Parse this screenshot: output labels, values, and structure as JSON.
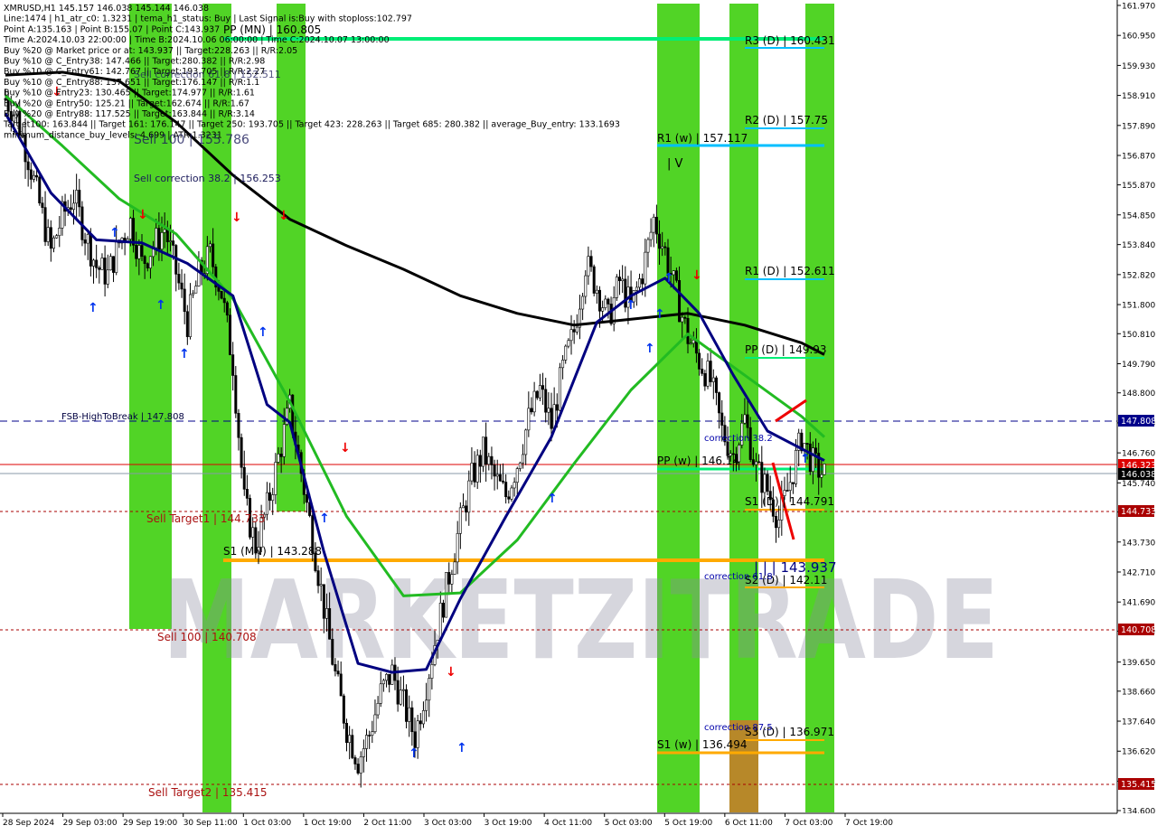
{
  "header_lines": [
    "XMRUSD,H1  145.157 146.038 145.144 146.038",
    "Line:1474 | h1_atr_c0: 1.3231 | tema_h1_status: Buy | Last Signal is:Buy with stoploss:102.797",
    "Point A:135.163 | Point B:155.07 | Point C:143.937",
    "Time A:2024.10.03 22:00:00 | Time B:2024.10.06 06:00:00 | Time C:2024.10.07 13:00:00",
    "Buy %20 @ Market price or at: 143.937 || Target:228.263 || R/R:2.05",
    "Buy %10 @ C_Entry38: 147.466 || Target:280.382 || R/R:2.98",
    "Buy %10 @ C_Entry61: 142.767 || Target:193.705 || R/R:2.27",
    "Buy %10 @ C_Entry88: 137.651 || Target:176.147 || R/R:1.1",
    "Buy %10 @ Entry23: 130.465 || Target:174.977 || R/R:1.61",
    "Buy %20 @ Entry50: 125.21 || Target:162.674 || R/R:1.67",
    "Buy %20 @ Entry88: 117.525 || Target:163.844 || R/R:3.14",
    "Target100: 163.844 || Target 161: 176.147 || Target 250: 193.705 || Target 423: 228.263 || Target 685: 280.382 || average_Buy_entry: 133.1693",
    "minimum_distance_buy_levels: 4.699 | ATR:1.3231"
  ],
  "overlay_labels": {
    "sell_correction_text": "Sell correction 38.2 | 156.253",
    "overlap_text_1": "Sell correction 61.8 | 152.511",
    "overlap_text_2": "Sell 100 | 155.786",
    "fsb_label": "FSB-HighToBreak | 147.808",
    "sell_target1": "Sell Target1 | 144.733",
    "sell_100": "Sell 100 | 140.708",
    "sell_target2": "Sell Target2 | 135.415",
    "pp_mn": "PP (MN) | 160.805",
    "s1_mn": "S1 (MN) | 143.288",
    "r3_d": "R3 (D) | 160.431",
    "r2_d": "R2 (D) | 157.75",
    "r1_w": "R1 (w) | 157.117",
    "r1_d": "R1 (D) | 152.611",
    "pp_d": "PP (D) | 149.93",
    "pp_w": "PP (w) | 146.14",
    "s1_d": "S1 (D) | 144.791",
    "s2_d": "S2 (D) | 142.11",
    "s3_d": "S3 (D) | 136.971",
    "s1_w": "S1 (w) | 136.494",
    "point_c_label": "| | | 143.937",
    "corr_382": "correction 38.2",
    "corr_618": "correction 61.8",
    "corr_875": "correction 87.5",
    "wave_mark": "| V",
    "watermark": "MARKETZITRADE"
  },
  "chart_data": {
    "type": "candlestick",
    "symbol": "XMRUSD",
    "timeframe": "H1",
    "ylim": [
      134.6,
      162.0
    ],
    "y_ticks": [
      161.97,
      160.95,
      159.93,
      158.91,
      157.89,
      156.87,
      155.87,
      154.85,
      153.84,
      152.82,
      151.8,
      150.81,
      149.79,
      148.8,
      147.78,
      146.76,
      145.74,
      144.75,
      143.73,
      142.71,
      141.69,
      140.7,
      139.65,
      138.66,
      137.64,
      136.62,
      135.6,
      134.6
    ],
    "x_ticks": [
      "28 Sep 2024",
      "29 Sep 03:00",
      "29 Sep 19:00",
      "30 Sep 11:00",
      "1 Oct 03:00",
      "1 Oct 19:00",
      "2 Oct 11:00",
      "3 Oct 03:00",
      "3 Oct 19:00",
      "4 Oct 11:00",
      "5 Oct 03:00",
      "5 Oct 19:00",
      "6 Oct 11:00",
      "7 Oct 03:00",
      "7 Oct 19:00"
    ],
    "close_path": [
      [
        0,
        158.8
      ],
      [
        4,
        158.2
      ],
      [
        8,
        156.8
      ],
      [
        12,
        155.2
      ],
      [
        16,
        153.6
      ],
      [
        20,
        154.8
      ],
      [
        24,
        155.5
      ],
      [
        28,
        154.2
      ],
      [
        32,
        153.1
      ],
      [
        36,
        152.8
      ],
      [
        40,
        153.9
      ],
      [
        44,
        154.6
      ],
      [
        48,
        153.2
      ],
      [
        52,
        153.8
      ],
      [
        56,
        154.4
      ],
      [
        60,
        152.9
      ],
      [
        64,
        151.2
      ],
      [
        68,
        152.8
      ],
      [
        72,
        153.5
      ],
      [
        76,
        152.2
      ],
      [
        80,
        149.8
      ],
      [
        84,
        145.1
      ],
      [
        88,
        143.6
      ],
      [
        92,
        144.9
      ],
      [
        96,
        146.6
      ],
      [
        100,
        148.3
      ],
      [
        104,
        146.1
      ],
      [
        108,
        143.9
      ],
      [
        112,
        141.5
      ],
      [
        116,
        139.2
      ],
      [
        120,
        137.4
      ],
      [
        124,
        136.3
      ],
      [
        128,
        137.2
      ],
      [
        132,
        138.6
      ],
      [
        136,
        139.3
      ],
      [
        140,
        138.2
      ],
      [
        144,
        137.1
      ],
      [
        148,
        138.9
      ],
      [
        152,
        140.8
      ],
      [
        156,
        142.6
      ],
      [
        160,
        144.4
      ],
      [
        164,
        145.9
      ],
      [
        168,
        146.8
      ],
      [
        172,
        145.9
      ],
      [
        176,
        145.3
      ],
      [
        180,
        146.4
      ],
      [
        184,
        147.9
      ],
      [
        188,
        148.9
      ],
      [
        192,
        147.7
      ],
      [
        196,
        149.6
      ],
      [
        200,
        150.9
      ],
      [
        204,
        153.2
      ],
      [
        208,
        152.4
      ],
      [
        212,
        151.3
      ],
      [
        216,
        152.6
      ],
      [
        220,
        151.7
      ],
      [
        224,
        152.9
      ],
      [
        228,
        154.7
      ],
      [
        232,
        153.6
      ],
      [
        236,
        152.1
      ],
      [
        240,
        150.7
      ],
      [
        244,
        149.9
      ],
      [
        248,
        149.2
      ],
      [
        252,
        147.5
      ],
      [
        256,
        146.7
      ],
      [
        260,
        147.9
      ],
      [
        264,
        146.2
      ],
      [
        268,
        145.5
      ],
      [
        272,
        144.5
      ],
      [
        276,
        145.8
      ],
      [
        280,
        147.3
      ],
      [
        284,
        146.4
      ],
      [
        288,
        146.0
      ]
    ],
    "series": [
      {
        "name": "",
        "color": "#000000",
        "points": [
          [
            0,
            159.6
          ],
          [
            20,
            159.7
          ],
          [
            40,
            159.4
          ],
          [
            60,
            158.0
          ],
          [
            80,
            156.2
          ],
          [
            100,
            154.7
          ],
          [
            120,
            153.8
          ],
          [
            140,
            153.0
          ],
          [
            160,
            152.1
          ],
          [
            180,
            151.5
          ],
          [
            200,
            151.1
          ],
          [
            220,
            151.3
          ],
          [
            240,
            151.5
          ],
          [
            260,
            151.1
          ],
          [
            280,
            150.5
          ],
          [
            288,
            150.1
          ]
        ]
      },
      {
        "name": "",
        "color": "#22bb22",
        "points": [
          [
            0,
            158.9
          ],
          [
            20,
            157.2
          ],
          [
            40,
            155.4
          ],
          [
            60,
            154.2
          ],
          [
            80,
            152.0
          ],
          [
            100,
            148.5
          ],
          [
            120,
            144.6
          ],
          [
            140,
            141.9
          ],
          [
            160,
            142.0
          ],
          [
            180,
            143.8
          ],
          [
            200,
            146.4
          ],
          [
            220,
            148.9
          ],
          [
            240,
            150.8
          ],
          [
            260,
            149.4
          ],
          [
            280,
            148.0
          ],
          [
            288,
            147.3
          ]
        ]
      },
      {
        "name": "",
        "color": "#000080",
        "points": [
          [
            0,
            158.3
          ],
          [
            16,
            155.6
          ],
          [
            32,
            154.0
          ],
          [
            48,
            153.9
          ],
          [
            64,
            153.2
          ],
          [
            80,
            152.1
          ],
          [
            92,
            148.4
          ],
          [
            100,
            147.8
          ],
          [
            112,
            143.4
          ],
          [
            124,
            139.6
          ],
          [
            136,
            139.3
          ],
          [
            148,
            139.4
          ],
          [
            160,
            141.8
          ],
          [
            176,
            144.6
          ],
          [
            192,
            147.3
          ],
          [
            208,
            151.2
          ],
          [
            220,
            152.1
          ],
          [
            232,
            152.7
          ],
          [
            244,
            151.5
          ],
          [
            256,
            149.4
          ],
          [
            268,
            147.5
          ],
          [
            280,
            146.9
          ],
          [
            288,
            146.5
          ]
        ]
      }
    ]
  },
  "price_labels": {
    "p147808": "147.808",
    "p146323": "146.323",
    "p146038": "146.038",
    "p144733": "144.733",
    "p140708": "140.708",
    "p135415": "135.415"
  },
  "colors": {
    "green_band": "#33cc00",
    "orange_band": "#c97a2a",
    "cyan_line": "#00bfff",
    "green_line": "#00ee77",
    "orange_line": "#ffaa00",
    "red": "#dd0000",
    "blue_dash": "#00008b",
    "watermark": "#9999aa"
  }
}
